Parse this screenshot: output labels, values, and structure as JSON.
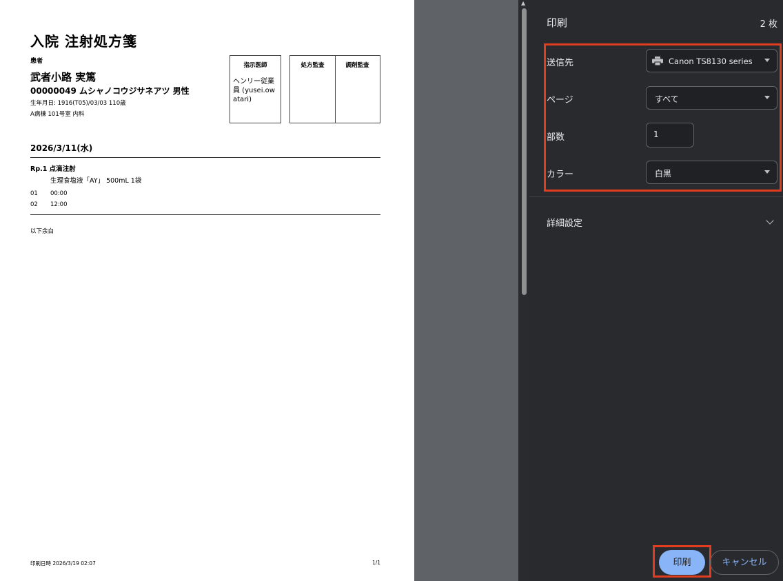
{
  "document": {
    "title": "入院 注射処方箋",
    "patient_label": "患者",
    "patient_name": "武者小路 実篤",
    "patient_id_line": "00000049 ムシャノコウジサネアツ 男性",
    "dob_line": "生年月日: 1916(T05)/03/03 110歳",
    "ward_line": "A病棟 101号室 内科",
    "doctor_box": {
      "header": "指示医師",
      "name": "ヘンリー従業員 (yusei.owatari)"
    },
    "audit_box": {
      "left_header": "処方監査",
      "right_header": "調剤監査"
    },
    "date": "2026/3/11(水)",
    "rp": {
      "label": "Rp.1  点滴注射",
      "drug": "生理食塩液「AY」 500mL 1袋",
      "times": [
        {
          "no": "01",
          "time": "00:00"
        },
        {
          "no": "02",
          "time": "12:00"
        }
      ]
    },
    "remarks": "以下余白",
    "footer_left": "印刷日時 2026/3/19 02:07",
    "footer_right": "1/1"
  },
  "print_dialog": {
    "title": "印刷",
    "sheet_count": "2 枚",
    "destination": {
      "label": "送信先",
      "value": "Canon TS8130 series",
      "icon": "printer-icon"
    },
    "pages": {
      "label": "ページ",
      "value": "すべて"
    },
    "copies": {
      "label": "部数",
      "value": "1"
    },
    "color": {
      "label": "カラー",
      "value": "白黒"
    },
    "more_settings": {
      "label": "詳細設定",
      "icon": "chevron-down-icon"
    },
    "print_button": "印刷",
    "cancel_button": "キャンセル",
    "highlight_color": "#e33d1f",
    "accent_color": "#8ab4f8"
  }
}
